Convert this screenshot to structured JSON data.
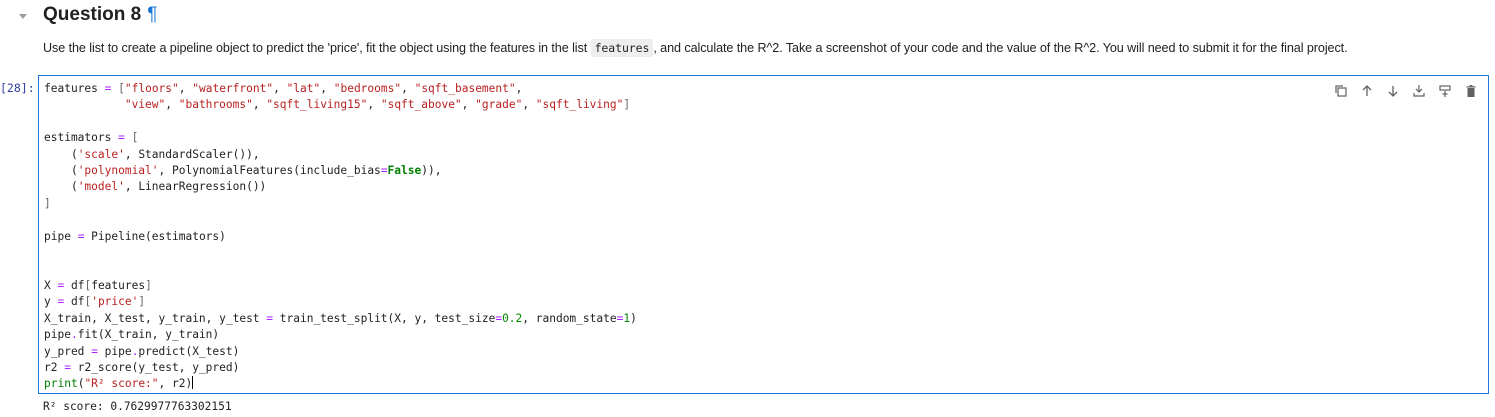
{
  "heading": {
    "title": "Question 8",
    "anchor": "¶"
  },
  "description": {
    "before": "Use the list to create a pipeline object to predict the 'price', fit the object using the features in the list ",
    "code": "features",
    "after": ", and calculate the R^2. Take a screenshot of your code and the value of the R^2. You will need to submit it for the final project."
  },
  "cell": {
    "prompt": "[28]:",
    "lines": [
      "features = [\"floors\", \"waterfront\", \"lat\", \"bedrooms\", \"sqft_basement\",",
      "            \"view\", \"bathrooms\", \"sqft_living15\", \"sqft_above\", \"grade\", \"sqft_living\"]",
      "",
      "estimators = [",
      "    ('scale', StandardScaler()),",
      "    ('polynomial', PolynomialFeatures(include_bias=False)),",
      "    ('model', LinearRegression())",
      "]",
      "",
      "pipe = Pipeline(estimators)",
      "",
      "",
      "X = df[features]",
      "y = df['price']",
      "X_train, X_test, y_train, y_test = train_test_split(X, y, test_size=0.2, random_state=1)",
      "pipe.fit(X_train, y_train)",
      "y_pred = pipe.predict(X_test)",
      "r2 = r2_score(y_test, y_pred)",
      "print(\"R² score:\", r2)"
    ],
    "output": "R² score: 0.7629977763302151"
  },
  "toolbar": {
    "icons": [
      "duplicate-icon",
      "move-up-icon",
      "move-down-icon",
      "insert-above-icon",
      "insert-below-icon",
      "delete-icon"
    ]
  },
  "colors": {
    "accent": "#1976d2",
    "prompt": "#303f9f",
    "string": "#ba2121",
    "keyword": "#008000",
    "operator": "#aa22ff"
  }
}
